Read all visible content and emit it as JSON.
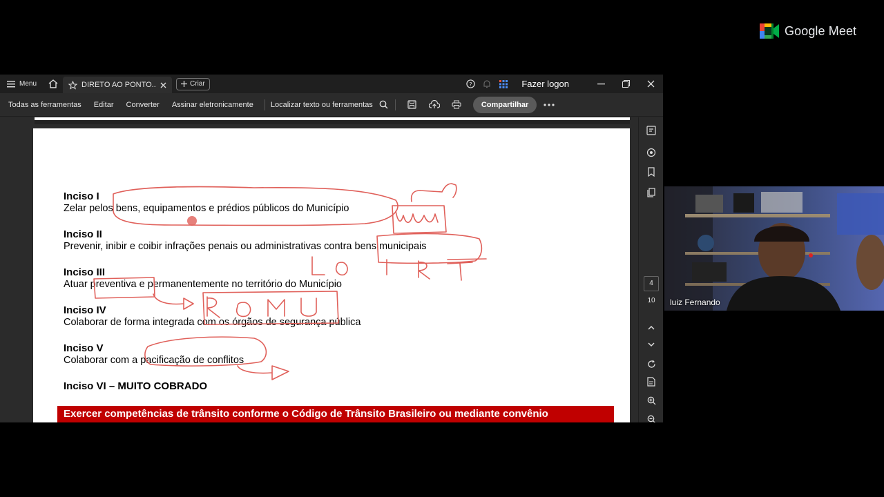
{
  "meet": {
    "logo_text": "Google Meet"
  },
  "titlebar": {
    "menu_label": "Menu",
    "tab_label": "DIRETO AO PONTO...",
    "create_label": "Criar",
    "login_label": "Fazer logon"
  },
  "toolbar": {
    "all_tools": "Todas as ferramentas",
    "edit": "Editar",
    "convert": "Converter",
    "sign": "Assinar eletronicamente",
    "find": "Localizar texto ou ferramentas",
    "share": "Compartilhar"
  },
  "document": {
    "incisos": [
      {
        "title": "Inciso I",
        "text": "Zelar pelos bens, equipamentos e prédios públicos do Município"
      },
      {
        "title": "Inciso II",
        "text": "Prevenir, inibir e coibir infrações penais ou administrativas contra bens municipais"
      },
      {
        "title": "Inciso III",
        "text": "Atuar preventiva e permanentemente no território do Município"
      },
      {
        "title": "Inciso IV",
        "text": "Colaborar de forma integrada com os órgãos de segurança pública"
      },
      {
        "title": "Inciso V",
        "text": "Colaborar com a pacificação de conflitos"
      },
      {
        "title": "Inciso VI – MUITO COBRADO",
        "text": ""
      }
    ],
    "banner": "Exercer competências de trânsito conforme o Código de Trânsito Brasileiro ou mediante convênio"
  },
  "sidebar": {
    "page_current": "4",
    "page_total": "10"
  },
  "participant": {
    "name": "luiz Fernando"
  },
  "colors": {
    "ink": "#e0605a",
    "banner": "#c00000",
    "background": "#000000"
  },
  "icons": [
    "menu-icon",
    "home-icon",
    "star-icon",
    "close-icon",
    "plus-icon",
    "help-icon",
    "bell-icon",
    "apps-icon",
    "minimize-icon",
    "restore-icon",
    "search-icon",
    "save-icon",
    "upload-icon",
    "print-icon",
    "more-icon",
    "comment-icon",
    "bookmark-icon",
    "pages-icon",
    "chevron-up-icon",
    "chevron-down-icon",
    "rotate-icon",
    "page-icon",
    "zoom-in-icon",
    "zoom-out-icon"
  ]
}
